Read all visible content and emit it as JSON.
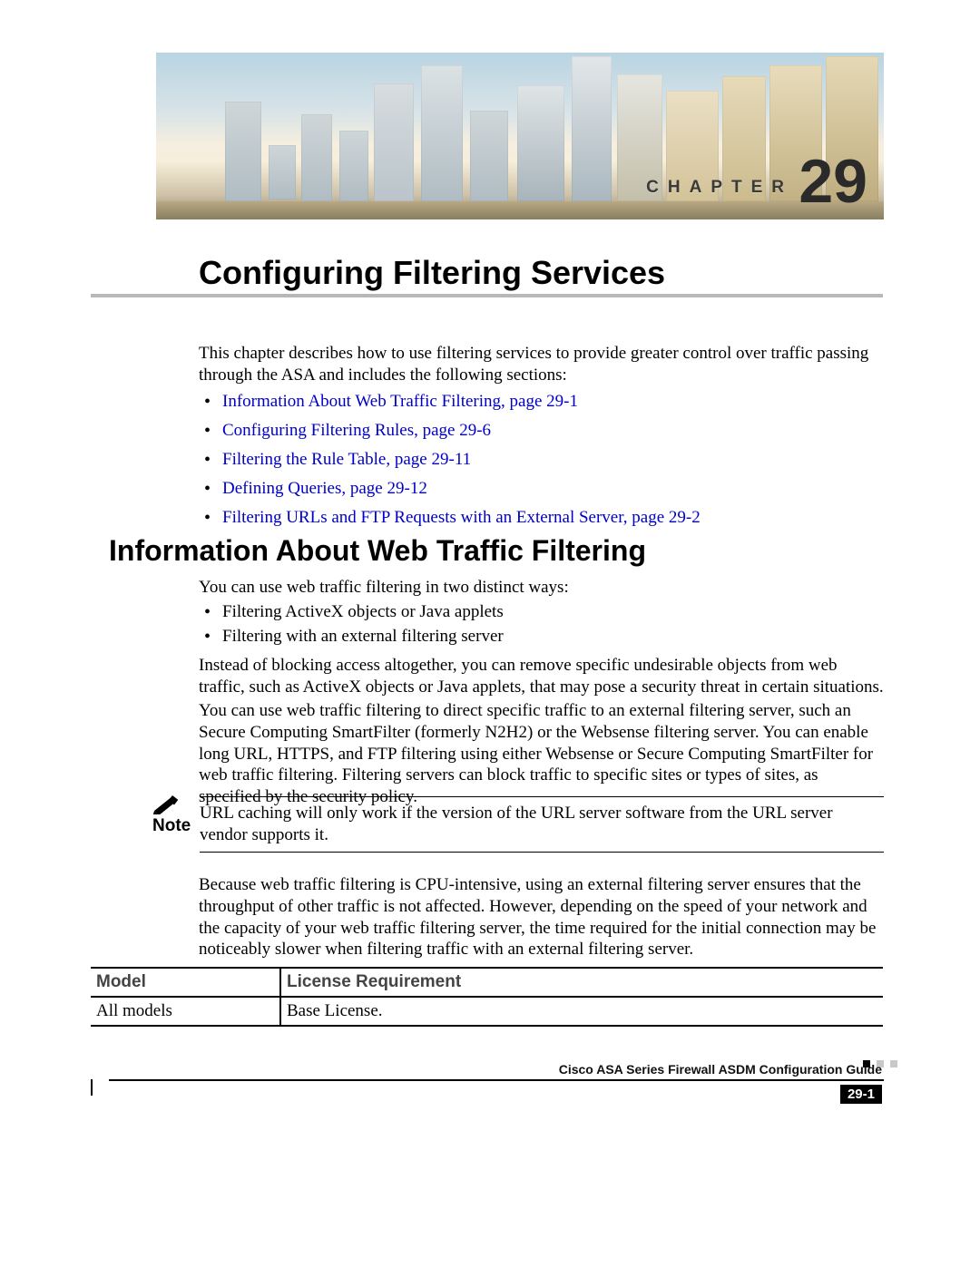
{
  "banner": {
    "chapter_label": "CHAPTER",
    "chapter_number": "29"
  },
  "title": "Configuring Filtering Services",
  "intro": "This chapter describes how to use filtering services to provide greater control over traffic passing through the ASA and includes the following sections:",
  "toc": [
    "Information About Web Traffic Filtering, page 29-1",
    "Configuring Filtering Rules, page 29-6",
    "Filtering the Rule Table, page 29-11",
    "Defining Queries, page 29-12",
    "Filtering URLs and FTP Requests with an External Server, page 29-2"
  ],
  "section1": {
    "heading": "Information About Web Traffic Filtering",
    "lead": "You can use web traffic filtering in two distinct ways:",
    "bullets": [
      "Filtering ActiveX objects or Java applets",
      "Filtering with an external filtering server"
    ],
    "para2": "Instead of blocking access altogether, you can remove specific undesirable objects from web traffic, such as ActiveX objects or Java applets, that may pose a security threat in certain situations.",
    "para3": "You can use web traffic filtering to direct specific traffic to an external filtering server, such an Secure Computing SmartFilter (formerly N2H2) or the Websense filtering server. You can enable long URL, HTTPS, and FTP filtering using either Websense or Secure Computing SmartFilter for web traffic filtering. Filtering servers can block traffic to specific sites or types of sites, as specified by the security policy.",
    "note_label": "Note",
    "note_text": "URL caching will only work if the version of the URL server software from the URL server vendor supports it.",
    "para4": "Because web traffic filtering is CPU-intensive, using an external filtering server ensures that the throughput of other traffic is not affected. However, depending on the speed of your network and the capacity of your web traffic filtering server, the time required for the initial connection may be noticeably slower when filtering traffic with an external filtering server."
  },
  "table": {
    "headers": {
      "col1": "Model",
      "col2": "License Requirement"
    },
    "row": {
      "col1": "All models",
      "col2": "Base License."
    }
  },
  "footer": {
    "guide": "Cisco ASA Series Firewall ASDM Configuration Guide",
    "page": "29-1"
  }
}
